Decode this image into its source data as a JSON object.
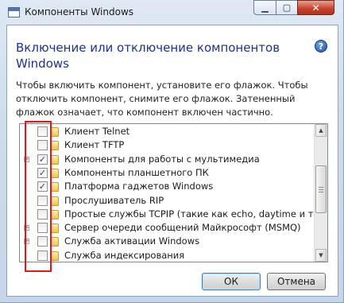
{
  "window": {
    "title": "Компоненты Windows",
    "minimize_glyph": "▁",
    "maximize_glyph": "▢",
    "close_glyph": "✕"
  },
  "main": {
    "heading_line1": "Включение или отключение компонентов",
    "heading_line2": "Windows",
    "help_glyph": "?",
    "description": "Чтобы включить компонент, установите его флажок. Чтобы отключить компонент, снимите его флажок. Затененный флажок означает, что компонент включен частично."
  },
  "features": [
    {
      "label": "Клиент Telnet",
      "checked": false,
      "expandable": false
    },
    {
      "label": "Клиент TFTP",
      "checked": false,
      "expandable": false
    },
    {
      "label": "Компоненты для работы с мультимедиа",
      "checked": true,
      "expandable": true
    },
    {
      "label": "Компоненты планшетного ПК",
      "checked": true,
      "expandable": false
    },
    {
      "label": "Платформа гаджетов Windows",
      "checked": true,
      "expandable": false
    },
    {
      "label": "Прослушиватель RIP",
      "checked": false,
      "expandable": false
    },
    {
      "label": "Простые службы TCPIP (такие как echo, daytime и т.п.)",
      "checked": false,
      "expandable": false
    },
    {
      "label": "Сервер очереди сообщений Майкрософт (MSMQ)",
      "checked": false,
      "expandable": true
    },
    {
      "label": "Служба активации Windows",
      "checked": false,
      "expandable": true
    },
    {
      "label": "Служба индексирования",
      "checked": false,
      "expandable": false
    }
  ],
  "scrollbar": {
    "up_glyph": "▲",
    "down_glyph": "▼"
  },
  "buttons": {
    "ok": "ОК",
    "cancel": "Отмена"
  },
  "colors": {
    "highlight": "#e0161b",
    "heading": "#1e3287",
    "check": "#21428a"
  }
}
